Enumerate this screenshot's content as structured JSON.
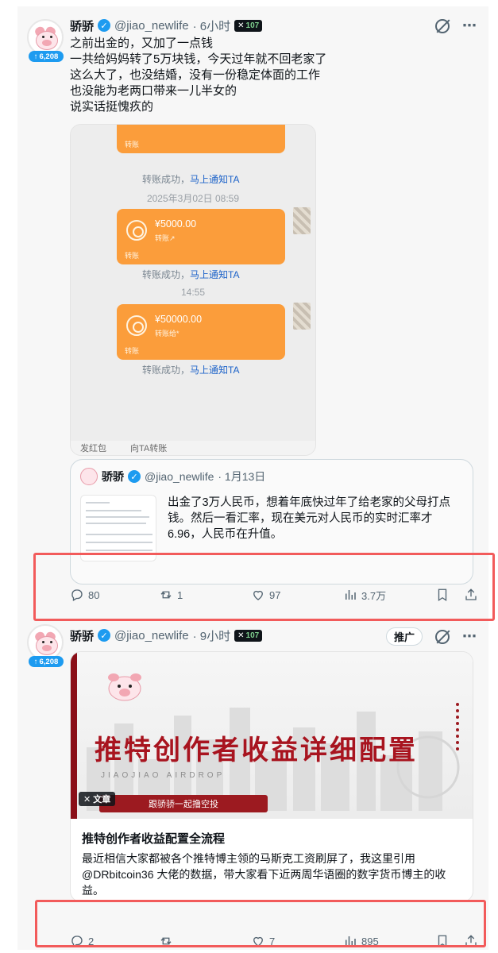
{
  "colors": {
    "accent": "#1d9bf0",
    "highlight_box": "#f25b5b",
    "transfer_bubble": "#fb9d3b",
    "banner_red": "#a8141f"
  },
  "tweet1": {
    "name": "骄骄",
    "handle": "@jiao_newlife",
    "time": "· 6小时",
    "xbadge_num": "107",
    "followers_badge": "6,208",
    "body": [
      "之前出金的，又加了一点钱",
      "一共给妈妈转了5万块钱，今天过年就不回老家了",
      "这么大了，也没结婚，没有一份稳定体面的工作",
      "也没能为老两口带来一儿半女的",
      "说实话挺愧疚的"
    ],
    "chat": {
      "status_1": "转账成功，",
      "notify_1": "马上通知TA",
      "timestamp_1": "2025年3月02日 08:59",
      "amount_1": "¥5000.00",
      "status_2": "转账成功，",
      "notify_2": "马上通知TA",
      "timestamp_2": "14:55",
      "amount_2": "¥50000.00",
      "status_3": "转账成功，",
      "notify_3": "马上通知TA",
      "bottom_left": "发红包",
      "bottom_right": "向TA转账"
    },
    "quote": {
      "name": "骄骄",
      "handle": "@jiao_newlife",
      "date": "· 1月13日",
      "text_lines": [
        "出金了3万人民币，想着年底快过年了给老家的父母打点",
        "钱。然后一看汇率，现在美元对人民币的实时汇率才",
        "6.96，人民币在升值。"
      ]
    },
    "actions": {
      "replies": "80",
      "reposts": "1",
      "likes": "97",
      "views": "3.7万"
    }
  },
  "tweet2": {
    "name": "骄骄",
    "handle": "@jiao_newlife",
    "time": "· 9小时",
    "xbadge_num": "107",
    "followers_badge": "6,208",
    "promo_label": "推广",
    "article": {
      "banner_title": "推特创作者收益详细配置",
      "banner_sub": "JIAOJIAO AIRDROP",
      "banner_ribbon": "跟骄骄一起撸空投",
      "tag": "文章",
      "title": "推特创作者收益配置全流程",
      "description": "最近相信大家都被各个推特博主领的马斯克工资刷屏了，我这里引用@DRbitcoin36 大佬的数据，带大家看下近两周华语圈的数字货币博主的收益。"
    },
    "actions": {
      "replies": "2",
      "reposts": "",
      "likes": "7",
      "views": "895"
    }
  }
}
